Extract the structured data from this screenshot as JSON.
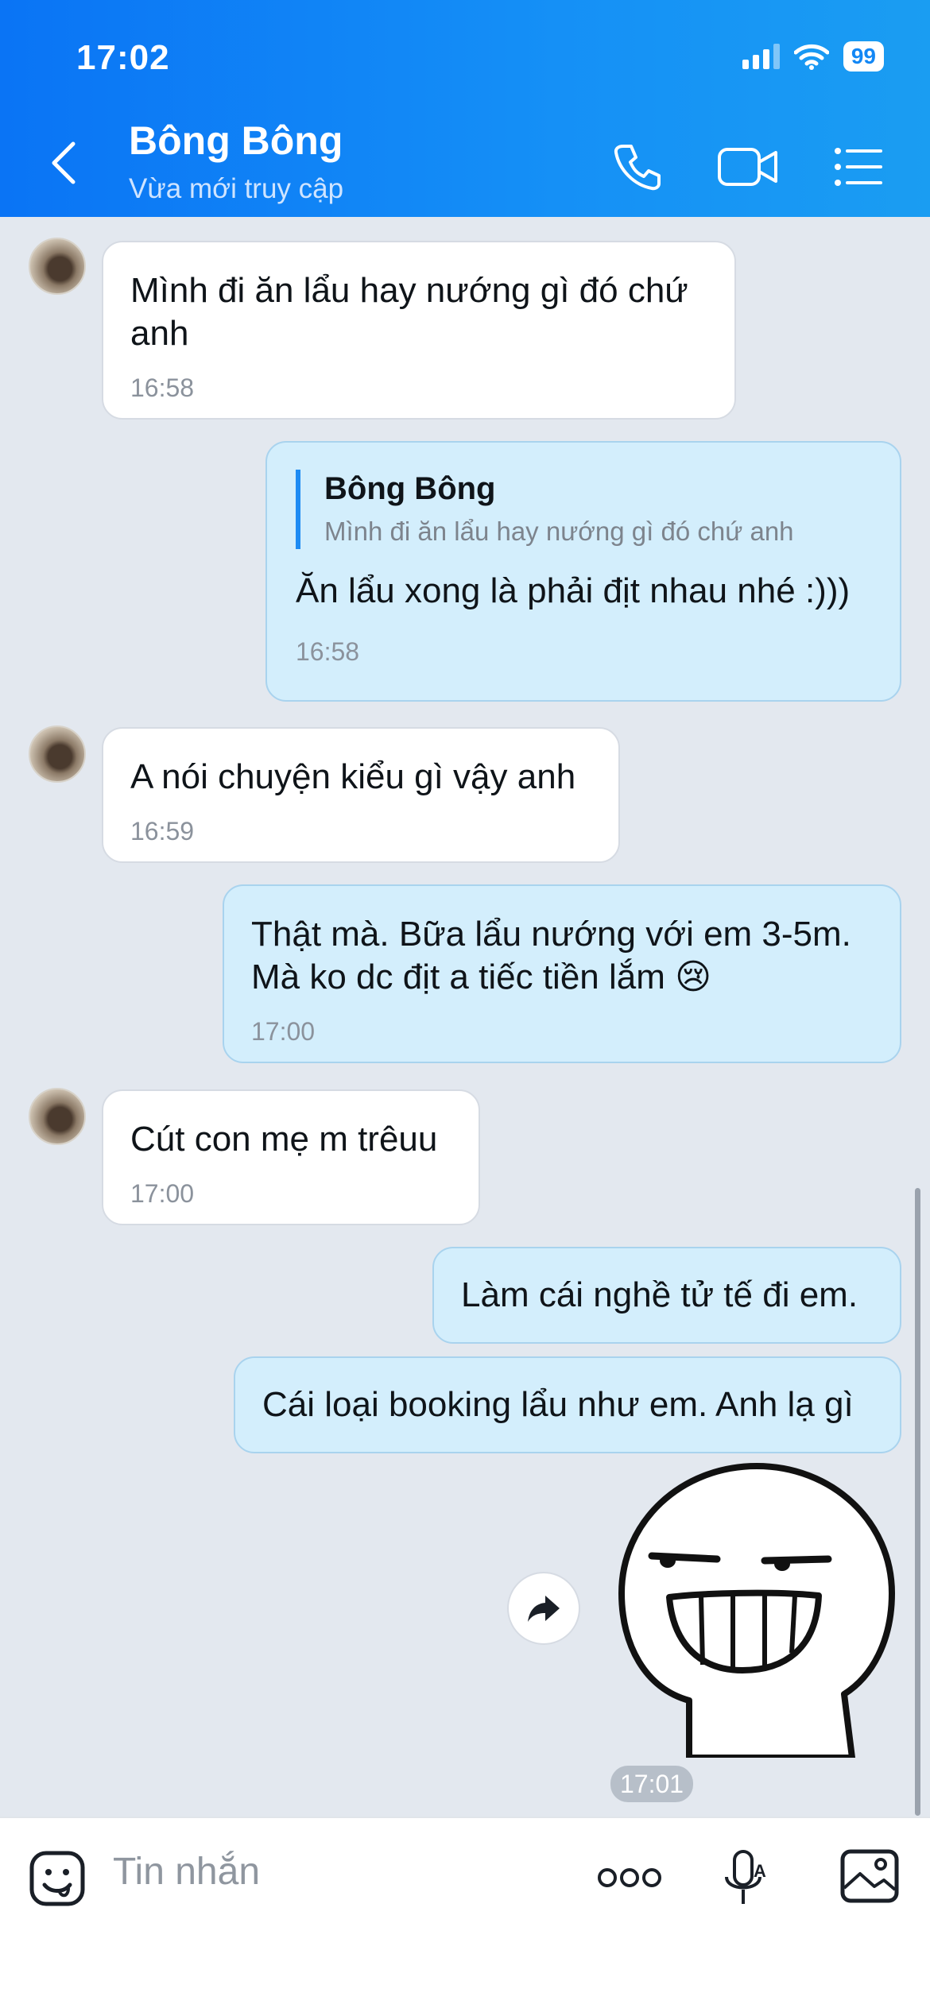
{
  "status_bar": {
    "time": "17:02",
    "battery": "99"
  },
  "header": {
    "title": "Bông Bông",
    "subtitle": "Vừa mới truy cập"
  },
  "messages": [
    {
      "direction": "incoming",
      "text": "Mình đi ăn lẩu hay nướng gì đó chứ\nanh",
      "time": "16:58"
    },
    {
      "direction": "outgoing",
      "quote_name": "Bông Bông",
      "quote_text": "Mình đi ăn lẩu hay nướng gì đó chứ anh",
      "text": "Ăn lẩu xong là phải địt nhau nhé :)))",
      "time": "16:58"
    },
    {
      "direction": "incoming",
      "text": "A nói chuyện kiểu gì vậy anh",
      "time": "16:59"
    },
    {
      "direction": "outgoing",
      "text": "Thật mà. Bữa lẩu nướng với em 3-5m.\nMà ko dc địt a tiếc tiền lắm 😢",
      "time": "17:00"
    },
    {
      "direction": "incoming",
      "text": "Cút con mẹ m trêuu",
      "time": "17:00"
    },
    {
      "direction": "outgoing",
      "text": "Làm cái nghề tử tế đi em."
    },
    {
      "direction": "outgoing",
      "text": "Cái loại booking lẩu như em. Anh lạ gì"
    },
    {
      "direction": "outgoing",
      "type": "sticker",
      "sticker": "grinning-face-sticker",
      "time": "17:01"
    }
  ],
  "input": {
    "placeholder": "Tin nhắn"
  },
  "icons": [
    "back-icon",
    "phone-icon",
    "video-call-icon",
    "menu-list-icon",
    "share-icon",
    "emoji-icon",
    "more-icon",
    "voice-icon",
    "image-icon"
  ],
  "colors": {
    "header_start": "#0a74f5",
    "header_end": "#1a9df2",
    "outgoing_bubble": "#d3eefc",
    "incoming_bubble": "#ffffff",
    "chat_background": "#e3e8ef"
  }
}
